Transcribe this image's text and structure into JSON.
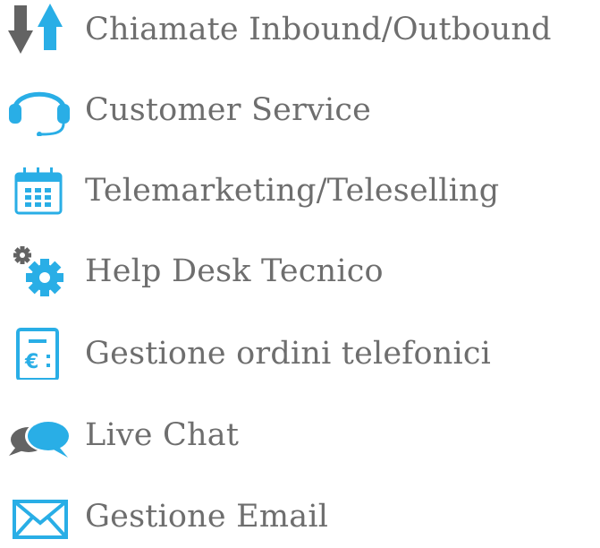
{
  "services": {
    "items": [
      {
        "label": "Chiamate Inbound/Outbound",
        "icon": "inbound-outbound-arrows-icon"
      },
      {
        "label": "Customer Service",
        "icon": "headset-icon"
      },
      {
        "label": "Telemarketing/Teleselling",
        "icon": "calendar-icon"
      },
      {
        "label": "Help Desk Tecnico",
        "icon": "gears-icon"
      },
      {
        "label": "Gestione ordini telefonici",
        "icon": "euro-receipt-icon"
      },
      {
        "label": "Live Chat",
        "icon": "chat-bubbles-icon"
      },
      {
        "label": "Gestione Email",
        "icon": "envelope-icon"
      }
    ]
  },
  "colors": {
    "accent_blue": "#29aee6",
    "icon_gray": "#636363",
    "text_gray": "#6e6e6e"
  }
}
